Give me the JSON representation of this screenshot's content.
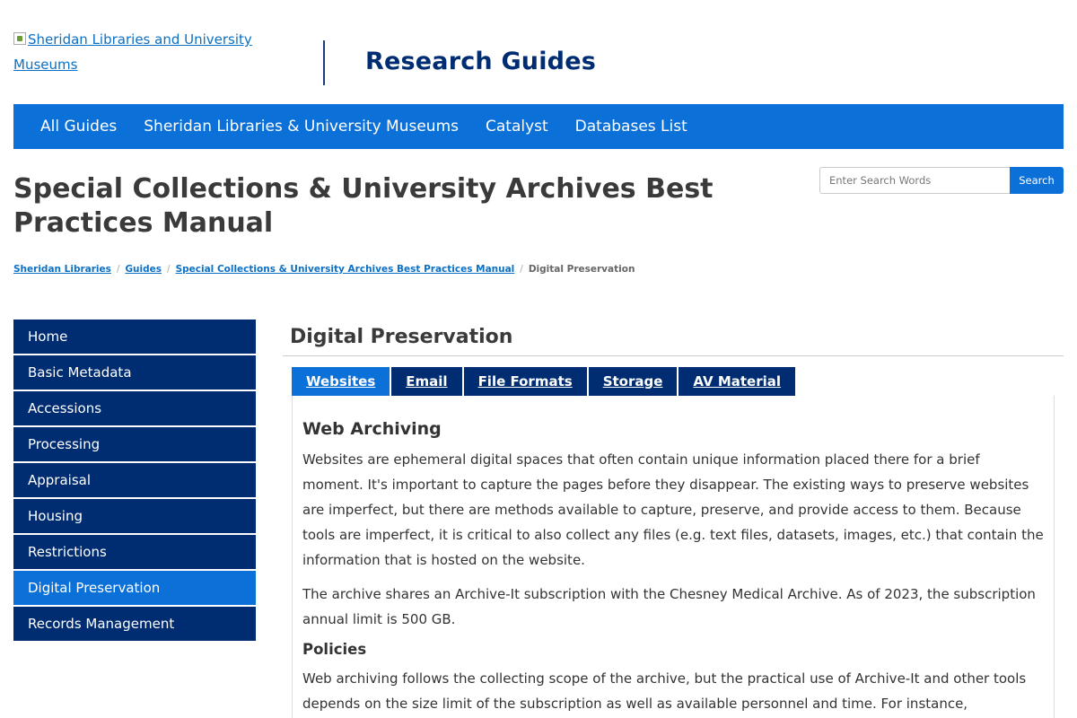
{
  "header": {
    "logo_alt": "Sheridan Libraries and University Museums",
    "site_title": "Research Guides"
  },
  "navbar": {
    "items": [
      "All Guides",
      "Sheridan Libraries & University Museums",
      "Catalyst",
      "Databases List"
    ]
  },
  "guide": {
    "title": "Special Collections & University Archives Best Practices Manual"
  },
  "search": {
    "placeholder": "Enter Search Words",
    "button_label": "Search"
  },
  "breadcrumb": {
    "items": [
      "Sheridan Libraries",
      "Guides",
      "Special Collections & University Archives Best Practices Manual"
    ],
    "current": "Digital Preservation"
  },
  "sidebar": {
    "items": [
      {
        "label": "Home"
      },
      {
        "label": "Basic Metadata"
      },
      {
        "label": "Accessions"
      },
      {
        "label": "Processing"
      },
      {
        "label": "Appraisal"
      },
      {
        "label": "Housing"
      },
      {
        "label": "Restrictions"
      },
      {
        "label": "Digital Preservation",
        "active": true
      },
      {
        "label": "Records Management"
      }
    ]
  },
  "main": {
    "heading": "Digital Preservation",
    "tabs": [
      {
        "label": "Websites",
        "active": true
      },
      {
        "label": "Email"
      },
      {
        "label": "File Formats"
      },
      {
        "label": "Storage"
      },
      {
        "label": "AV Material"
      }
    ],
    "content": {
      "heading": "Web Archiving",
      "para1": "Websites are ephemeral digital spaces that often contain unique information placed there for a brief moment. It's important to capture the pages before they disappear. The existing ways to preserve websites are imperfect, but there are methods available to capture, preserve, and provide access to them. Because tools are imperfect, it is critical to also collect any files (e.g. text files, datasets, images, etc.) that contain the information that is hosted on the website.",
      "para2": "The archive shares an Archive-It subscription with the Chesney Medical Archive. As of 2023, the subscription annual limit is 500 GB.",
      "subheading": "Policies",
      "para3": "Web archiving follows the collecting scope of the archive, but the practical use of Archive-It and other tools depends on the size limit of the subscription as well as available personnel and time. For instance,"
    }
  },
  "colors": {
    "primary_blue": "#0c70d9",
    "navy": "#002d72",
    "link": "#0c70c5"
  }
}
